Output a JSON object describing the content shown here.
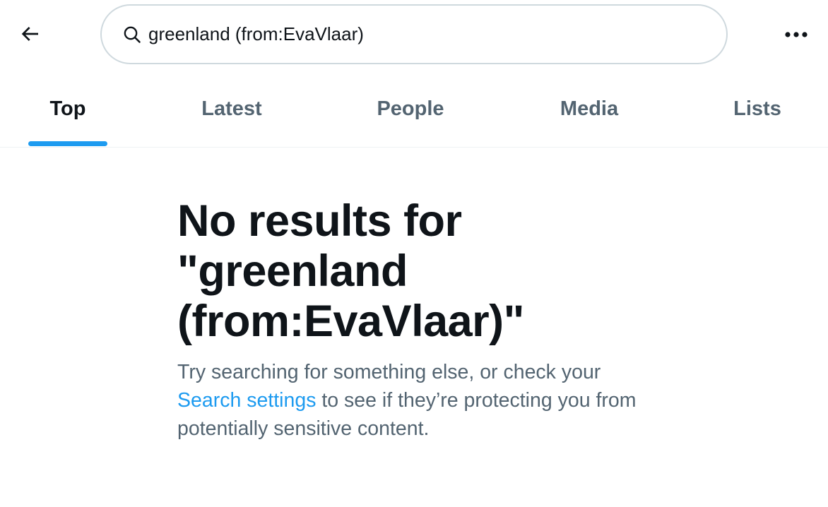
{
  "header": {
    "search": {
      "value": "greenland (from:EvaVlaar)",
      "icon": "search-icon"
    },
    "back_icon": "back-arrow-icon",
    "more_icon": "more-icon"
  },
  "tabs": [
    {
      "label": "Top",
      "active": true
    },
    {
      "label": "Latest",
      "active": false
    },
    {
      "label": "People",
      "active": false
    },
    {
      "label": "Media",
      "active": false
    },
    {
      "label": "Lists",
      "active": false
    }
  ],
  "empty_state": {
    "title_line1": "No results for",
    "title_line2": "\"greenland",
    "title_line3": "(from:EvaVlaar)\"",
    "message_before": "Try searching for something else, or check your ",
    "link_label": "Search settings",
    "message_after": " to see if they’re protecting you from potentially sensitive content."
  },
  "colors": {
    "accent": "#1d9bf0",
    "text_primary": "#0f1419",
    "text_secondary": "#536471",
    "border": "#cfd9de"
  }
}
